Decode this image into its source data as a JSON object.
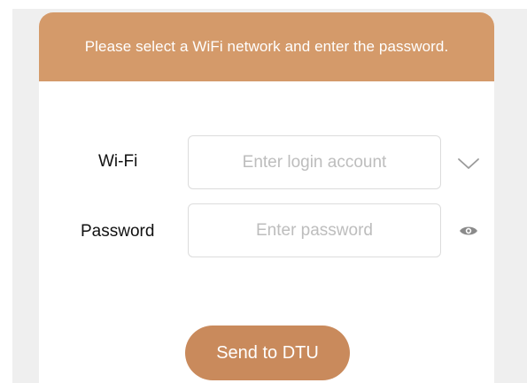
{
  "banner": {
    "text": "Please select a WiFi network and enter the password."
  },
  "form": {
    "wifi": {
      "label": "Wi-Fi",
      "placeholder": "Enter login account",
      "value": "",
      "dropdown_icon": "chevron-down-icon"
    },
    "password": {
      "label": "Password",
      "placeholder": "Enter password",
      "value": "",
      "visibility_icon": "eye-icon"
    }
  },
  "actions": {
    "send_label": "Send to DTU"
  },
  "colors": {
    "accent": "#d49a6a",
    "button": "#c98a5c",
    "background": "#efefef",
    "placeholder": "#bdbdbd"
  }
}
